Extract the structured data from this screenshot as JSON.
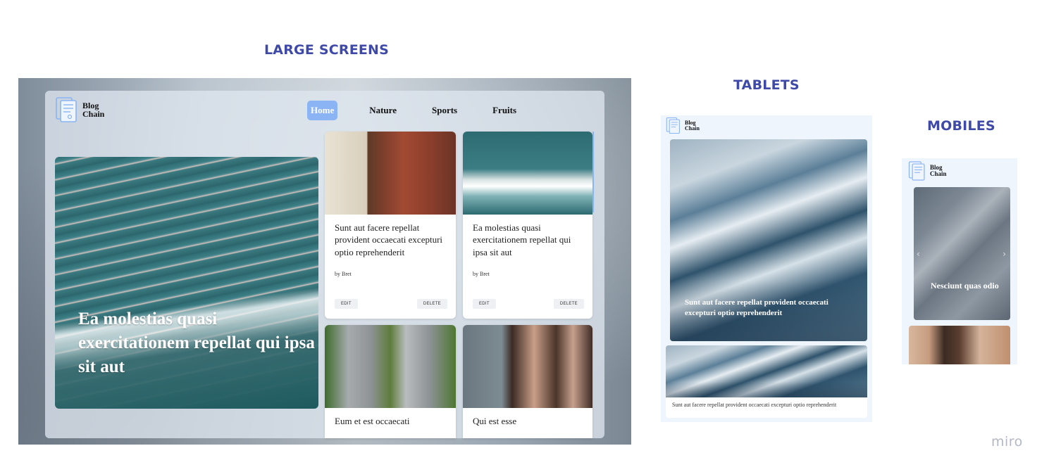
{
  "sections": {
    "large": "LARGE SCREENS",
    "tablets": "TABLETS",
    "mobiles": "MOBILES"
  },
  "logo": {
    "line1": "Blog",
    "line2": "Chain",
    "icon": "blog-document-icon"
  },
  "nav": [
    {
      "label": "Home",
      "active": true
    },
    {
      "label": "Nature",
      "active": false
    },
    {
      "label": "Sports",
      "active": false
    },
    {
      "label": "Fruits",
      "active": false
    }
  ],
  "large": {
    "hero_title": "Ea molestias quasi exercitationem repellat qui ipsa sit aut",
    "cards": [
      {
        "title": "Sunt aut facere repellat provident occaecati excepturi optio reprehenderit",
        "author": "by Bret",
        "edit": "EDIT",
        "delete": "DELETE"
      },
      {
        "title": "Ea molestias quasi exercitationem repellat qui ipsa sit aut",
        "author": "by Bret",
        "edit": "EDIT",
        "delete": "DELETE"
      },
      {
        "title": "Eum et est occaecati"
      },
      {
        "title": "Qui est esse"
      }
    ]
  },
  "tablet": {
    "hero_title": "Sunt aut facere repellat provident occaecati excepturi optio reprehenderit",
    "card_title": "Sunt aut facere repellat provident occaecati excepturi optio reprehenderit"
  },
  "mobile": {
    "hero_title": "Nesciunt quas odio",
    "prev_icon": "chevron-left-icon",
    "next_icon": "chevron-right-icon"
  },
  "watermark": "miro",
  "colors": {
    "heading": "#3f4aa8",
    "nav_active": "#8ab4f3"
  }
}
